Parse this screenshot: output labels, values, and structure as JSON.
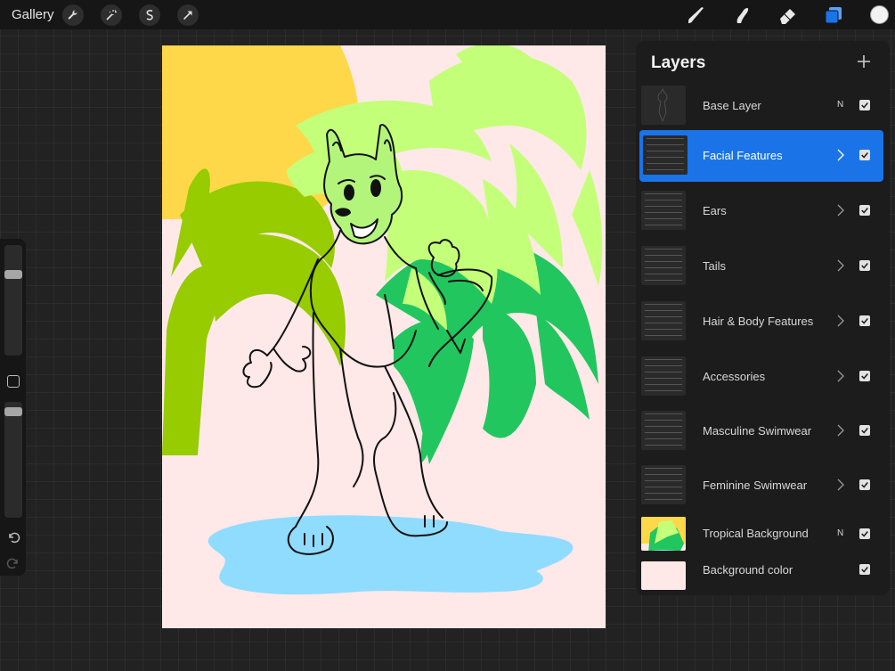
{
  "toolbar": {
    "gallery_label": "Gallery",
    "left_tools": [
      "wrench-icon",
      "magic-wand-icon",
      "selection-icon",
      "transform-icon"
    ],
    "right_tools": [
      "brush-icon",
      "smudge-icon",
      "eraser-icon",
      "layers-icon"
    ],
    "current_color": "#f2f2f2",
    "accent_color": "#1a74e8"
  },
  "sidebar": {
    "brush_size": 0.12,
    "brush_opacity": 0.05
  },
  "layers": {
    "title": "Layers",
    "items": [
      {
        "name": "Base Layer",
        "mode": "N",
        "visible": true,
        "group": false
      },
      {
        "name": "Facial Features",
        "mode": "",
        "visible": true,
        "group": true,
        "selected": true
      },
      {
        "name": "Ears",
        "mode": "",
        "visible": true,
        "group": true
      },
      {
        "name": "Tails",
        "mode": "",
        "visible": true,
        "group": true
      },
      {
        "name": "Hair & Body Features",
        "mode": "",
        "visible": true,
        "group": true
      },
      {
        "name": "Accessories",
        "mode": "",
        "visible": true,
        "group": true
      },
      {
        "name": "Masculine Swimwear",
        "mode": "",
        "visible": true,
        "group": true
      },
      {
        "name": "Feminine Swimwear",
        "mode": "",
        "visible": true,
        "group": true
      },
      {
        "name": "Tropical Background",
        "mode": "N",
        "visible": true,
        "group": false
      },
      {
        "name": "Background color",
        "mode": "",
        "visible": true,
        "group": false
      }
    ]
  },
  "canvas": {
    "background": "#ffe8e8",
    "sun_color": "#ffd84a",
    "palm_light": "#c4ff7a",
    "palm_mid": "#96cc00",
    "palm_dark": "#22c65e",
    "water_color": "#8fdcff",
    "character_head": "#b3f57a"
  }
}
